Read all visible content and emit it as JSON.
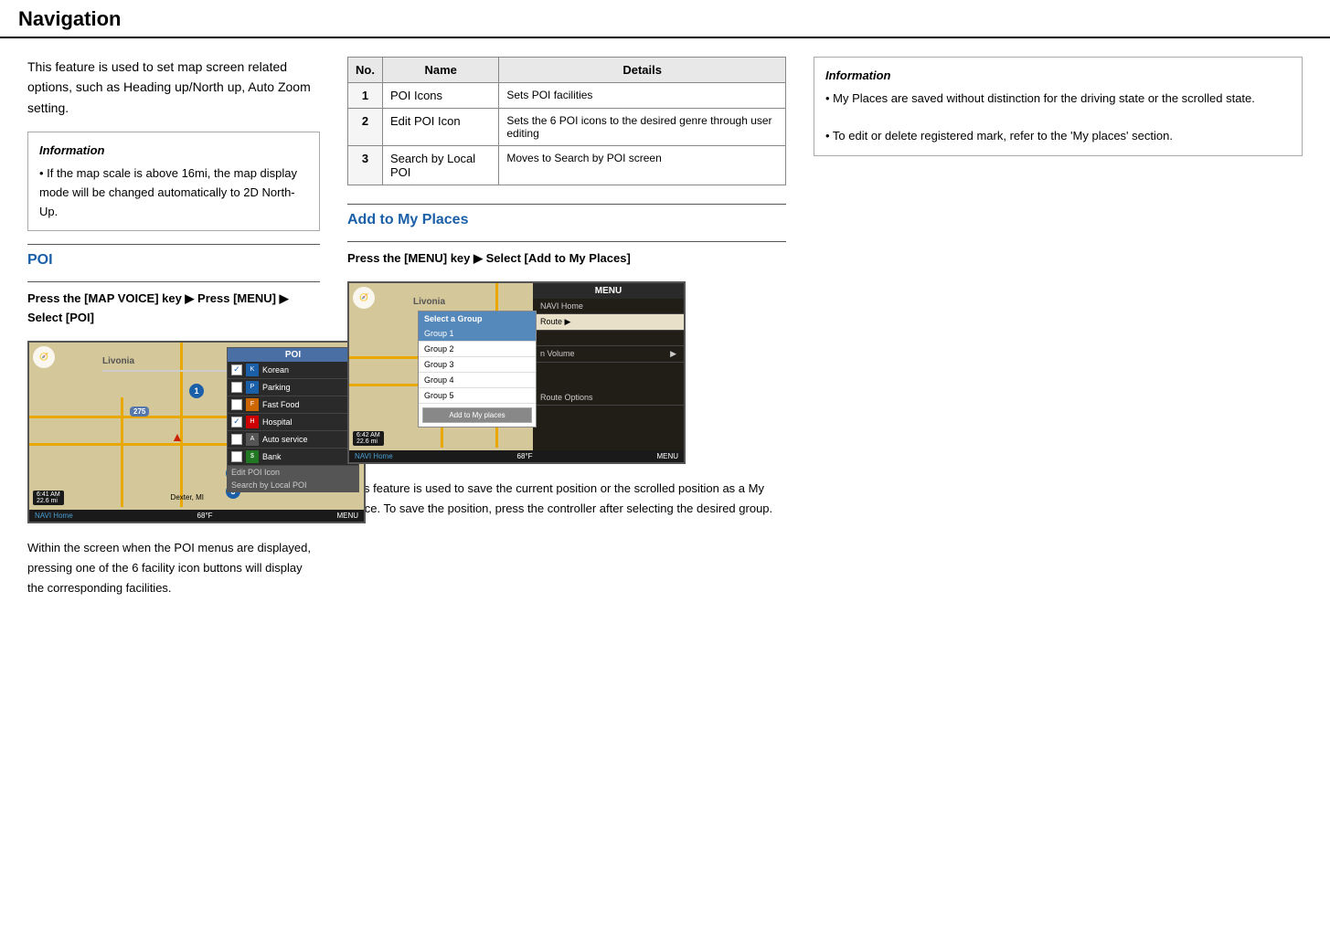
{
  "header": {
    "title": "Navigation"
  },
  "left_section": {
    "intro": "This feature is used to set map screen related options, such as Heading up/North up, Auto Zoom setting.",
    "info_title": "Information",
    "info_bullets": [
      "If the map scale is above 16mi, the map display mode will be changed automatically to 2D North-Up."
    ],
    "section_heading": "POI",
    "instruction": "Press the [MAP VOICE] key ▶ Press [MENU] ▶ Select [POI]",
    "bottom_text": "Within the screen when the POI menus are displayed, pressing one of the 6 facility icon buttons will display the corresponding facilities."
  },
  "middle_section": {
    "table": {
      "headers": [
        "No.",
        "Name",
        "Details"
      ],
      "rows": [
        {
          "no": "1",
          "name": "POI Icons",
          "details": "Sets POI facilities"
        },
        {
          "no": "2",
          "name": "Edit POI Icon",
          "details": "Sets the 6 POI icons to the desired genre through user editing"
        },
        {
          "no": "3",
          "name": "Search by Local POI",
          "details": "Moves to Search by POI screen"
        }
      ]
    },
    "section_heading": "Add to My Places",
    "instruction": "Press the [MENU] key ▶ Select [Add to My Places]",
    "bottom_text": "This feature is used to save the current position or the scrolled position as a My Place. To save the position, press the controller after selecting the desired group."
  },
  "right_section": {
    "info_title": "Information",
    "info_bullets": [
      "My Places are saved without distinction for the driving state or the scrolled state.",
      "To edit or delete registered mark, refer to the 'My places' section."
    ]
  },
  "poi_screenshot": {
    "location": "Livonia",
    "time": "6:41 AM",
    "distance": "22.6 mi",
    "temp": "68°F",
    "home_label": "NAVI Home",
    "menu_label": "MENU",
    "dexter": "Dexter, MI",
    "poi_header": "POI",
    "items": [
      {
        "checked": true,
        "label": "Korean"
      },
      {
        "checked": false,
        "label": "Parking"
      },
      {
        "checked": false,
        "label": "Fast Food"
      },
      {
        "checked": true,
        "label": "Hospital"
      },
      {
        "checked": false,
        "label": "Auto service"
      },
      {
        "checked": false,
        "label": "Bank"
      }
    ],
    "actions": [
      "Edit POI Icon",
      "Search by Local POI"
    ],
    "badges": [
      "1",
      "2",
      "3"
    ]
  },
  "add_screenshot": {
    "location": "Livonia",
    "time": "6:42 AM",
    "distance": "22.6 mi",
    "temp": "68°F",
    "home_label": "NAVI Home",
    "menu_label": "MENU",
    "menu_title": "MENU",
    "menu_items": [
      "NAVI Home",
      "Route",
      "",
      "n Volume ▶"
    ],
    "group_header": "Select a Group",
    "groups": [
      "Group 1",
      "Group 2",
      "Group 3",
      "Group 4",
      "Group 5"
    ],
    "add_btn": "Add to My places",
    "route_options": "Route Options"
  }
}
